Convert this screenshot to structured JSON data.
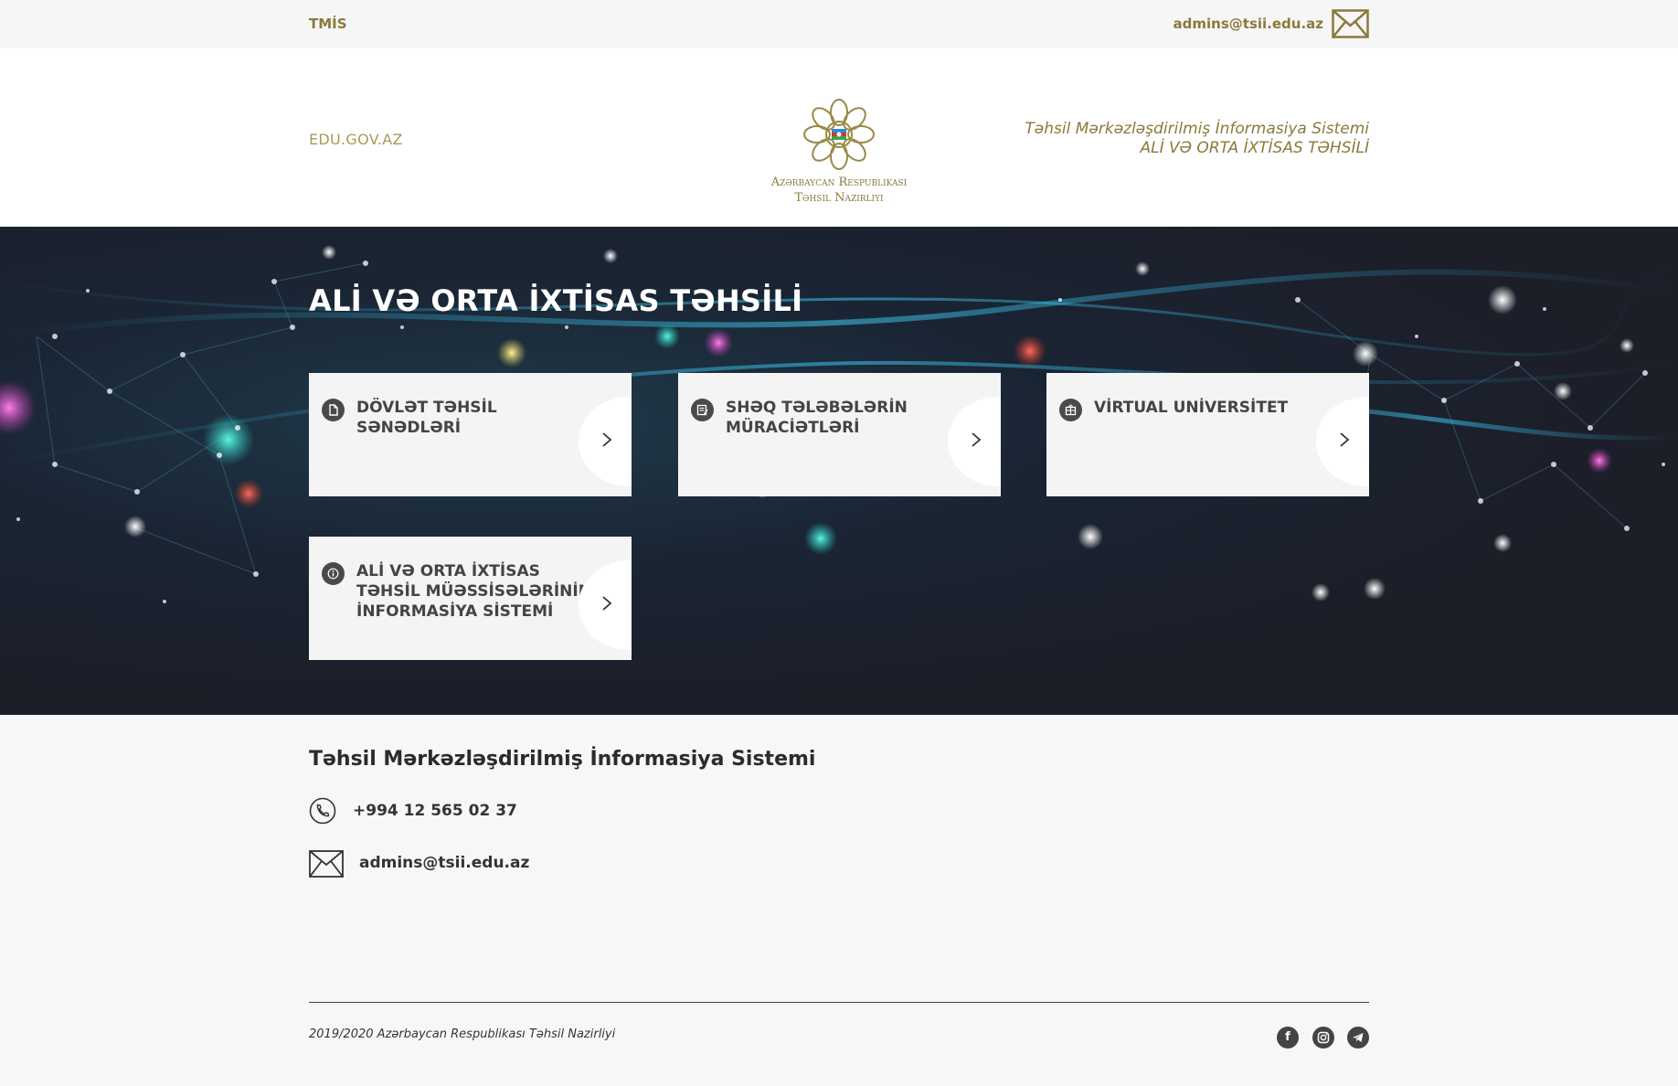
{
  "topbar": {
    "brand": "TMİS",
    "email": "admins@tsii.edu.az",
    "mail_icon": "envelope-icon"
  },
  "header": {
    "edu_link": "EDU.GOV.AZ",
    "ministry_line1": "Azərbaycan Respublikası",
    "ministry_line2": "Təhsil Nazirliyi",
    "system_line1": "Təhsil Mərkəzləşdirilmiş İnformasiya Sistemi",
    "system_line2": "ALİ VƏ ORTA İXTİSAS TƏHSİLİ"
  },
  "hero": {
    "title": "ALİ VƏ ORTA İXTİSAS TƏHSİLİ",
    "cards": [
      {
        "label": "DÖVLƏT TƏHSİL SƏNƏDLƏRİ",
        "icon": "document-icon"
      },
      {
        "label": "SHƏQ TƏLƏBƏLƏRİN MÜRACİƏTLƏRİ",
        "icon": "edit-note-icon"
      },
      {
        "label": "VİRTUAL UNİVERSİTET",
        "icon": "building-icon"
      },
      {
        "label": "ALİ VƏ ORTA İXTİSAS TƏHSİL MÜƏSSİSƏLƏRİNİN İNFORMASİYA SİSTEMİ",
        "icon": "info-icon"
      }
    ]
  },
  "footer": {
    "title": "Təhsil Mərkəzləşdirilmiş İnformasiya Sistemi",
    "phone": "+994 12 565 02 37",
    "email": "admins@tsii.edu.az",
    "copyright": "2019/2020 Azərbaycan Respublikası Təhsil Nazirliyi",
    "social": [
      "facebook-icon",
      "instagram-icon",
      "telegram-icon"
    ]
  },
  "colors": {
    "gold": "#8a7a3a",
    "light_gold": "#a89a55",
    "hero_dark": "#1c1e28",
    "card_bg": "#f4f4f4"
  }
}
